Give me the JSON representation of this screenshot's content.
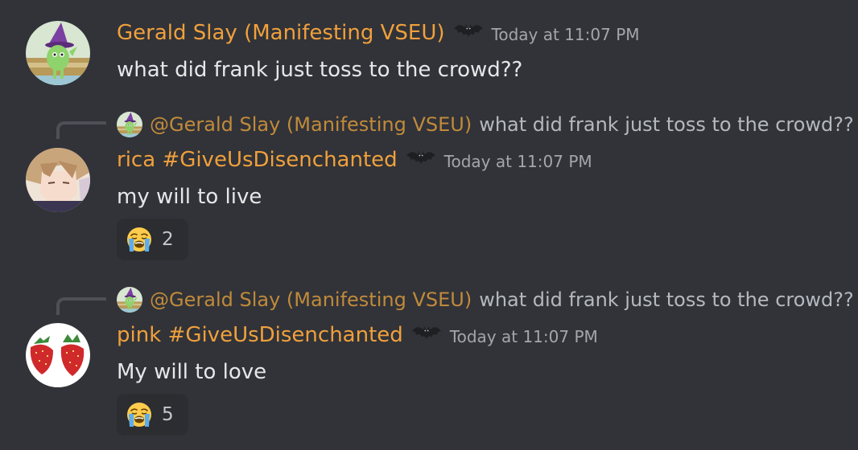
{
  "messages": [
    {
      "username": "Gerald Slay (Manifesting VSEU)",
      "badge_icon": "bat-icon",
      "timestamp": "Today at 11:07 PM",
      "content": "what did frank just toss to the crowd??"
    },
    {
      "reply": {
        "mention": "@Gerald Slay (Manifesting VSEU)",
        "text": "what did frank just toss to the crowd??"
      },
      "username": "rica #GiveUsDisenchanted",
      "badge_icon": "bat-icon",
      "timestamp": "Today at 11:07 PM",
      "content": "my will to live",
      "reaction": {
        "emoji": "loudly-crying-face",
        "count": "2"
      }
    },
    {
      "reply": {
        "mention": "@Gerald Slay (Manifesting VSEU)",
        "text": "what did frank just toss to the crowd??"
      },
      "username": "pink #GiveUsDisenchanted",
      "badge_icon": "bat-icon",
      "timestamp": "Today at 11:07 PM",
      "content": "My will to love",
      "reaction": {
        "emoji": "loudly-crying-face",
        "count": "5"
      }
    }
  ],
  "colors": {
    "background": "#313338",
    "username": "#f0a03c",
    "reply_username": "#c18a3b",
    "text": "#e6e7e9",
    "muted": "#a3a6aa",
    "reaction_bg": "#2b2d31"
  }
}
